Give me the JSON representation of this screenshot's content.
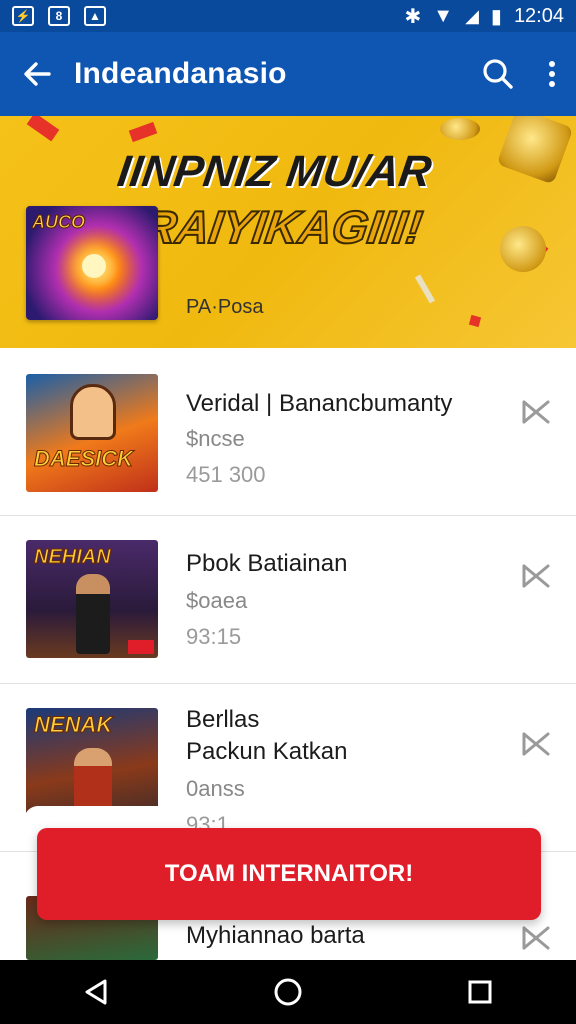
{
  "status_bar": {
    "time": "12:04",
    "left_icons": [
      "app-icon-1",
      "app-icon-2",
      "app-icon-3"
    ],
    "right_icons": [
      "bluetooth-icon",
      "wifi-icon",
      "signal-icon",
      "battery-icon"
    ]
  },
  "app_bar": {
    "title": "Indeandanasio",
    "back_icon": "back-arrow-icon",
    "search_icon": "search-icon",
    "more_icon": "more-vert-icon"
  },
  "banner": {
    "headline_line1": "IINPNIZ MU/AR",
    "headline_line2": "RRAIYIKAGIII!",
    "thumb_label": "AUCO",
    "subtitle": "PA·Posa"
  },
  "items": [
    {
      "title": "Veridal | Banancbumanty",
      "subtitle": "$ncse",
      "meta": "451 300",
      "thumb_label": "DAESICK"
    },
    {
      "title": "Pbok Batiainan",
      "subtitle": "$oaea",
      "meta": "93:15",
      "thumb_label": "NEHIAN"
    },
    {
      "title": "Berllas",
      "title2": "Packun Katkan",
      "subtitle": "0anss",
      "meta": "93:1",
      "thumb_label": "NENAK"
    },
    {
      "title": "Myhiannao barta",
      "subtitle": "",
      "meta": "",
      "thumb_label": ""
    }
  ],
  "cta": {
    "label": "TOAM INTERNAITOR!"
  },
  "colors": {
    "primary": "#0f56b3",
    "status": "#0a4a9c",
    "banner": "#f5c21a",
    "cta": "#e01e2a"
  },
  "nav": [
    "back-triangle-icon",
    "home-circle-icon",
    "recents-square-icon"
  ]
}
